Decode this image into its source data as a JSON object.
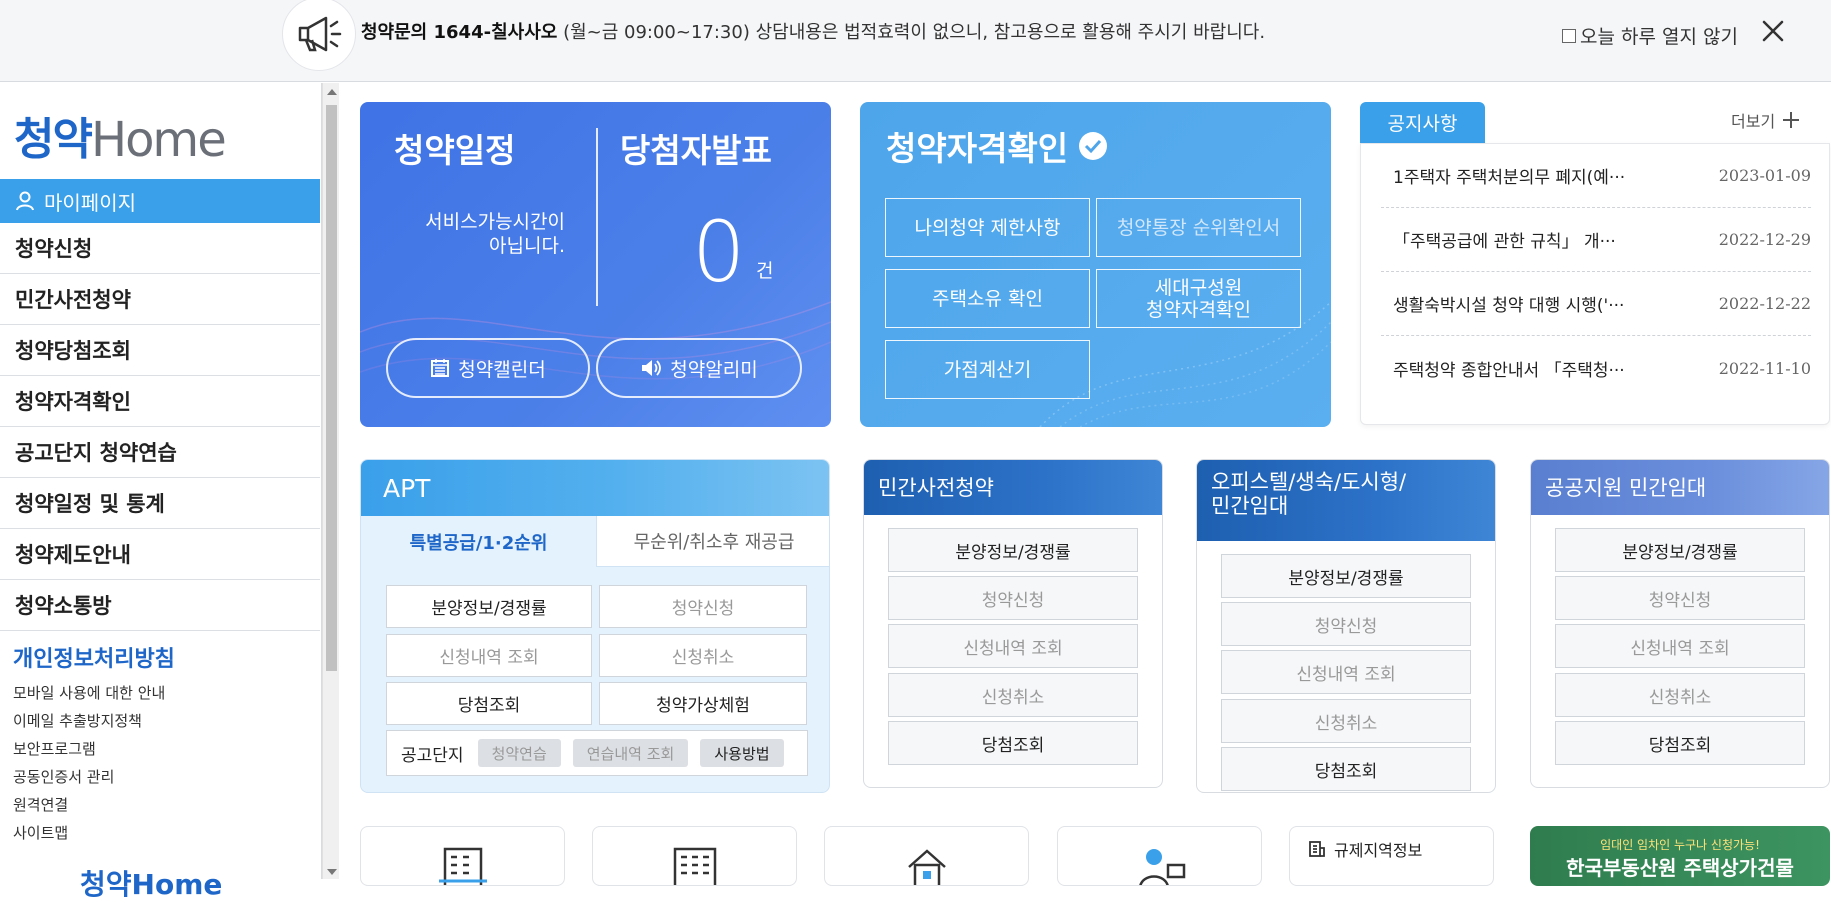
{
  "notice_bar": {
    "main": "청약문의 1644-칠사사오",
    "hours": "(월~금 09:00~17:30)",
    "disclaimer": "상담내용은 법적효력이 없으니, 참고용으로 활용해 주시기 바랍니다.",
    "dont_show_label": "오늘 하루 열지 않기"
  },
  "logo": {
    "korean": "청약",
    "english": "Home"
  },
  "sidebar": {
    "mypage_label": "마이페이지",
    "menu": [
      "청약신청",
      "민간사전청약",
      "청약당첨조회",
      "청약자격확인",
      "공고단지 청약연습",
      "청약일정 및 통계",
      "청약제도안내",
      "청약소통방"
    ],
    "privacy_title": "개인정보처리방침",
    "sublinks": [
      "모바일 사용에 대한 안내",
      "이메일 추출방지정책",
      "보안프로그램",
      "공동인증서 관리",
      "원격연결",
      "사이트맵"
    ],
    "bottom_logo": "청약Home"
  },
  "schedule_panel": {
    "title_schedule": "청약일정",
    "title_winner": "당첨자발표",
    "service_line1": "서비스가능시간이",
    "service_line2": "아닙니다.",
    "count": "0",
    "count_unit": "건",
    "calendar_button": "청약캘린더",
    "alert_button": "청약알리미"
  },
  "eligibility_panel": {
    "title": "청약자격확인",
    "buttons": [
      "나의청약 제한사항",
      "청약통장 순위확인서",
      "주택소유 확인",
      "세대구성원",
      "청약자격확인",
      "가점계산기"
    ]
  },
  "notices": {
    "tab_label": "공지사항",
    "more_label": "더보기",
    "items": [
      {
        "title": "1주택자 주택처분의무 폐지(예···",
        "date": "2023-01-09"
      },
      {
        "title": "「주택공급에 관한 규칙」 개···",
        "date": "2022-12-29"
      },
      {
        "title": "생활숙박시설 청약 대행 시행('···",
        "date": "2022-12-22"
      },
      {
        "title": "주택청약 종합안내서 「주택청···",
        "date": "2022-11-10"
      }
    ]
  },
  "apt": {
    "title": "APT",
    "tab_active": "특별공급/1·2순위",
    "tab_inactive": "무순위/취소후 재공급",
    "buttons": [
      "분양정보/경쟁률",
      "청약신청",
      "신청내역 조회",
      "신청취소",
      "당첨조회",
      "청약가상체험"
    ],
    "bar_label": "공고단지",
    "bar_pills": [
      "청약연습",
      "연습내역 조회",
      "사용방법"
    ]
  },
  "cards": [
    {
      "title": "민간사전청약",
      "buttons": [
        "분양정보/경쟁률",
        "청약신청",
        "신청내역 조회",
        "신청취소",
        "당첨조회"
      ]
    },
    {
      "title_line1": "오피스텔/생숙/도시형/",
      "title_line2": "민간임대",
      "buttons": [
        "분양정보/경쟁률",
        "청약신청",
        "신청내역 조회",
        "신청취소",
        "당첨조회"
      ]
    },
    {
      "title": "공공지원 민간임대",
      "buttons": [
        "분양정보/경쟁률",
        "청약신청",
        "신청내역 조회",
        "신청취소",
        "당첨조회"
      ]
    }
  ],
  "bottom": {
    "region_label": "규제지역정보",
    "banner_line1": "임대인 임차인 누구나 신청가능!",
    "banner_line2": "한국부동산원 주택상가건물"
  },
  "colors": {
    "primary_blue": "#3f73e6",
    "sky_blue": "#3aa0ea",
    "navy": "#1e5fb0",
    "link_blue": "#1e66c8"
  },
  "icons": [
    "megaphone-icon",
    "close-icon",
    "person-icon",
    "calendar-icon",
    "speaker-icon",
    "check-circle-icon",
    "plus-icon",
    "building-icon",
    "apartment-icon",
    "house-icon",
    "consultant-icon",
    "region-icon"
  ]
}
